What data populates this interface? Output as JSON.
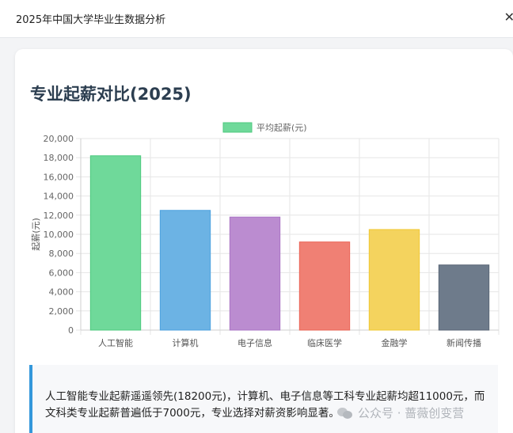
{
  "app": {
    "title": "2025年中国大学毕业生数据分析",
    "close_glyph": "✕"
  },
  "card": {
    "title": "专业起薪对比(2025)"
  },
  "chart_data": {
    "type": "bar",
    "categories": [
      "人工智能",
      "计算机",
      "电子信息",
      "临床医学",
      "金融学",
      "新闻传播"
    ],
    "series": [
      {
        "name": "平均起薪(元)",
        "values": [
          18200,
          12500,
          11800,
          9200,
          10500,
          6800
        ],
        "colors": [
          "#6fd99a",
          "#6cb3e4",
          "#bb8cd0",
          "#f08074",
          "#f4d35e",
          "#6e7b8b"
        ],
        "border_colors": [
          "#4cc97e",
          "#4da2df",
          "#a974c4",
          "#ea6456",
          "#f1c832",
          "#5a6676"
        ]
      }
    ],
    "title": "",
    "xlabel": "",
    "ylabel": "起薪(元)",
    "ylim": [
      0,
      20000
    ],
    "y_ticks": [
      "0",
      "2,000",
      "4,000",
      "6,000",
      "8,000",
      "10,000",
      "12,000",
      "14,000",
      "16,000",
      "18,000",
      "20,000"
    ],
    "grid": true,
    "legend": "top-center",
    "legend_color": "#6fd99a"
  },
  "note": {
    "text": "人工智能专业起薪遥遥领先(18200元)，计算机、电子信息等工科专业起薪均超11000元，而文科类专业起薪普遍低于7000元，专业选择对薪资影响显著。"
  },
  "watermark": {
    "text": "公众号 · 蔷薇创变营"
  }
}
